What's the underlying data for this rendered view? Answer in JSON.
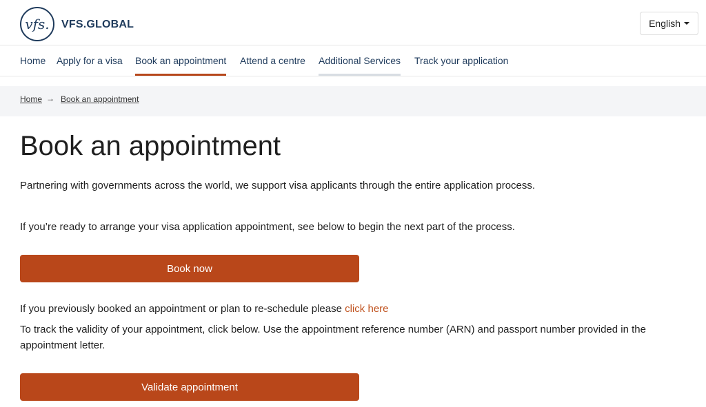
{
  "header": {
    "logo_mark": "vfs.",
    "logo_text": "VFS.GLOBAL",
    "language": "English"
  },
  "nav": {
    "items": [
      {
        "label": "Home"
      },
      {
        "label": "Apply for a visa"
      },
      {
        "label": "Book an appointment"
      },
      {
        "label": "Attend a centre"
      },
      {
        "label": "Additional Services"
      },
      {
        "label": "Track your application"
      }
    ]
  },
  "breadcrumb": {
    "home": "Home",
    "arrow": "→",
    "current": "Book an appointment"
  },
  "main": {
    "title": "Book an appointment",
    "intro": "Partnering with governments across the world, we support visa applicants through the entire application process.",
    "ready_text": "If you’re ready to arrange your visa application appointment, see below to begin the next part of the process.",
    "book_button": "Book now",
    "reschedule_text": "If you previously booked an appointment or plan to re-schedule please",
    "reschedule_link": "click here",
    "track_text": "To track the validity of your appointment, click below. Use the appointment reference number (ARN) and passport number provided in the appointment letter.",
    "validate_button": "Validate appointment"
  },
  "colors": {
    "brand_navy": "#1f3b5c",
    "accent_orange": "#b9471a",
    "link_orange": "#c0531f"
  }
}
